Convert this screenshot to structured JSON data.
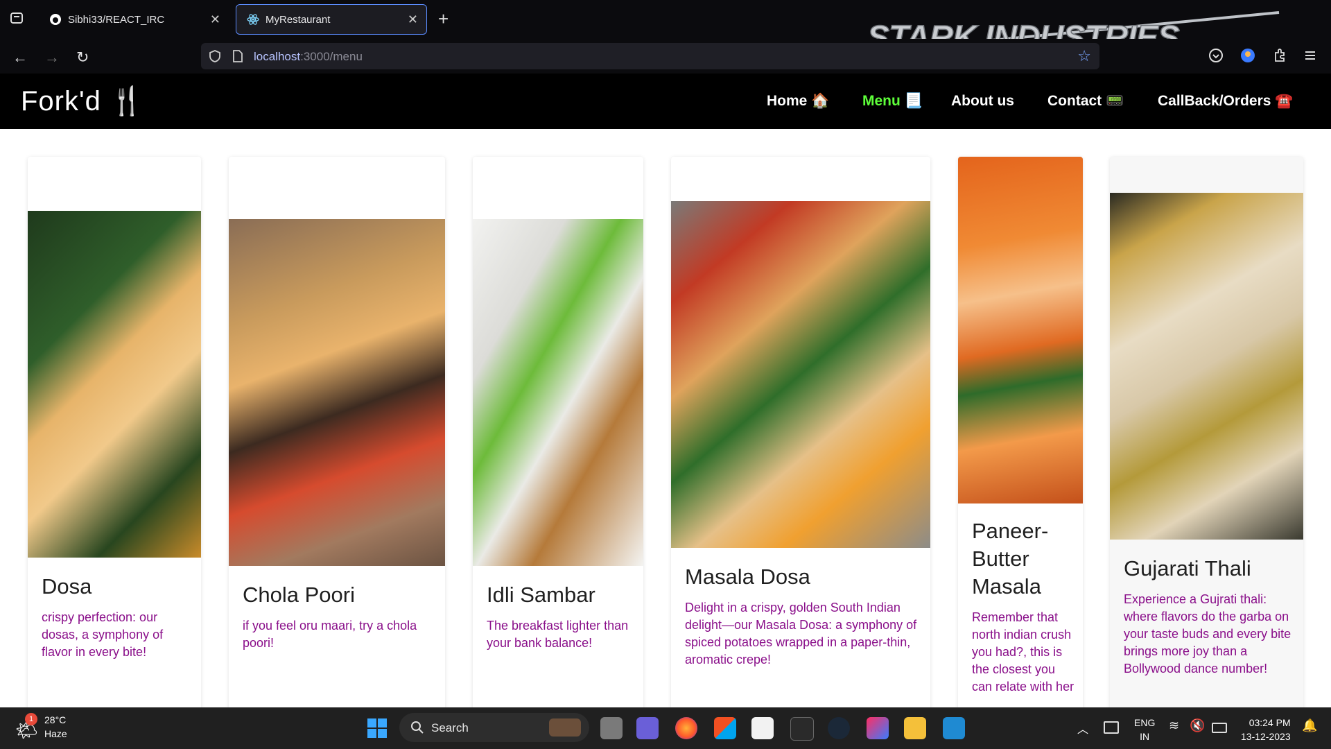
{
  "browser": {
    "tabs": [
      {
        "label": "Sibhi33/REACT_IRC",
        "icon": "github-icon"
      },
      {
        "label": "MyRestaurant",
        "icon": "react-icon"
      }
    ],
    "url_host": "localhost",
    "url_path": ":3000/menu",
    "theme_text": "STARK INDUSTRIES"
  },
  "site": {
    "brand": "Fork'd 🍴",
    "nav": [
      {
        "label": "Home 🏠"
      },
      {
        "label": "Menu 📃"
      },
      {
        "label": "About us"
      },
      {
        "label": "Contact 📟"
      },
      {
        "label": "CallBack/Orders ☎️"
      }
    ]
  },
  "menu": [
    {
      "title": "Dosa",
      "desc": "crispy perfection: our dosas, a symphony of flavor in every bite!"
    },
    {
      "title": "Chola Poori",
      "desc": "if you feel oru maari, try a chola poori!"
    },
    {
      "title": "Idli Sambar",
      "desc": "The breakfast lighter than your bank balance!"
    },
    {
      "title": "Masala Dosa",
      "desc": "Delight in a crispy, golden South Indian delight—our Masala Dosa: a symphony of spiced potatoes wrapped in a paper-thin, aromatic crepe!"
    },
    {
      "title": "Paneer-Butter Masala",
      "desc": "Remember that north indian crush you had?, this is the closest you can relate with her"
    },
    {
      "title": "Gujarati Thali",
      "desc": "Experience a Gujrati thali: where flavors do the garba on your taste buds and every bite brings more joy than a Bollywood dance number!"
    }
  ],
  "taskbar": {
    "weather_badge": "1",
    "temp": "28°C",
    "condition": "Haze",
    "search_label": "Search",
    "lang1": "ENG",
    "lang2": "IN",
    "time": "03:24 PM",
    "date": "13-12-2023"
  }
}
